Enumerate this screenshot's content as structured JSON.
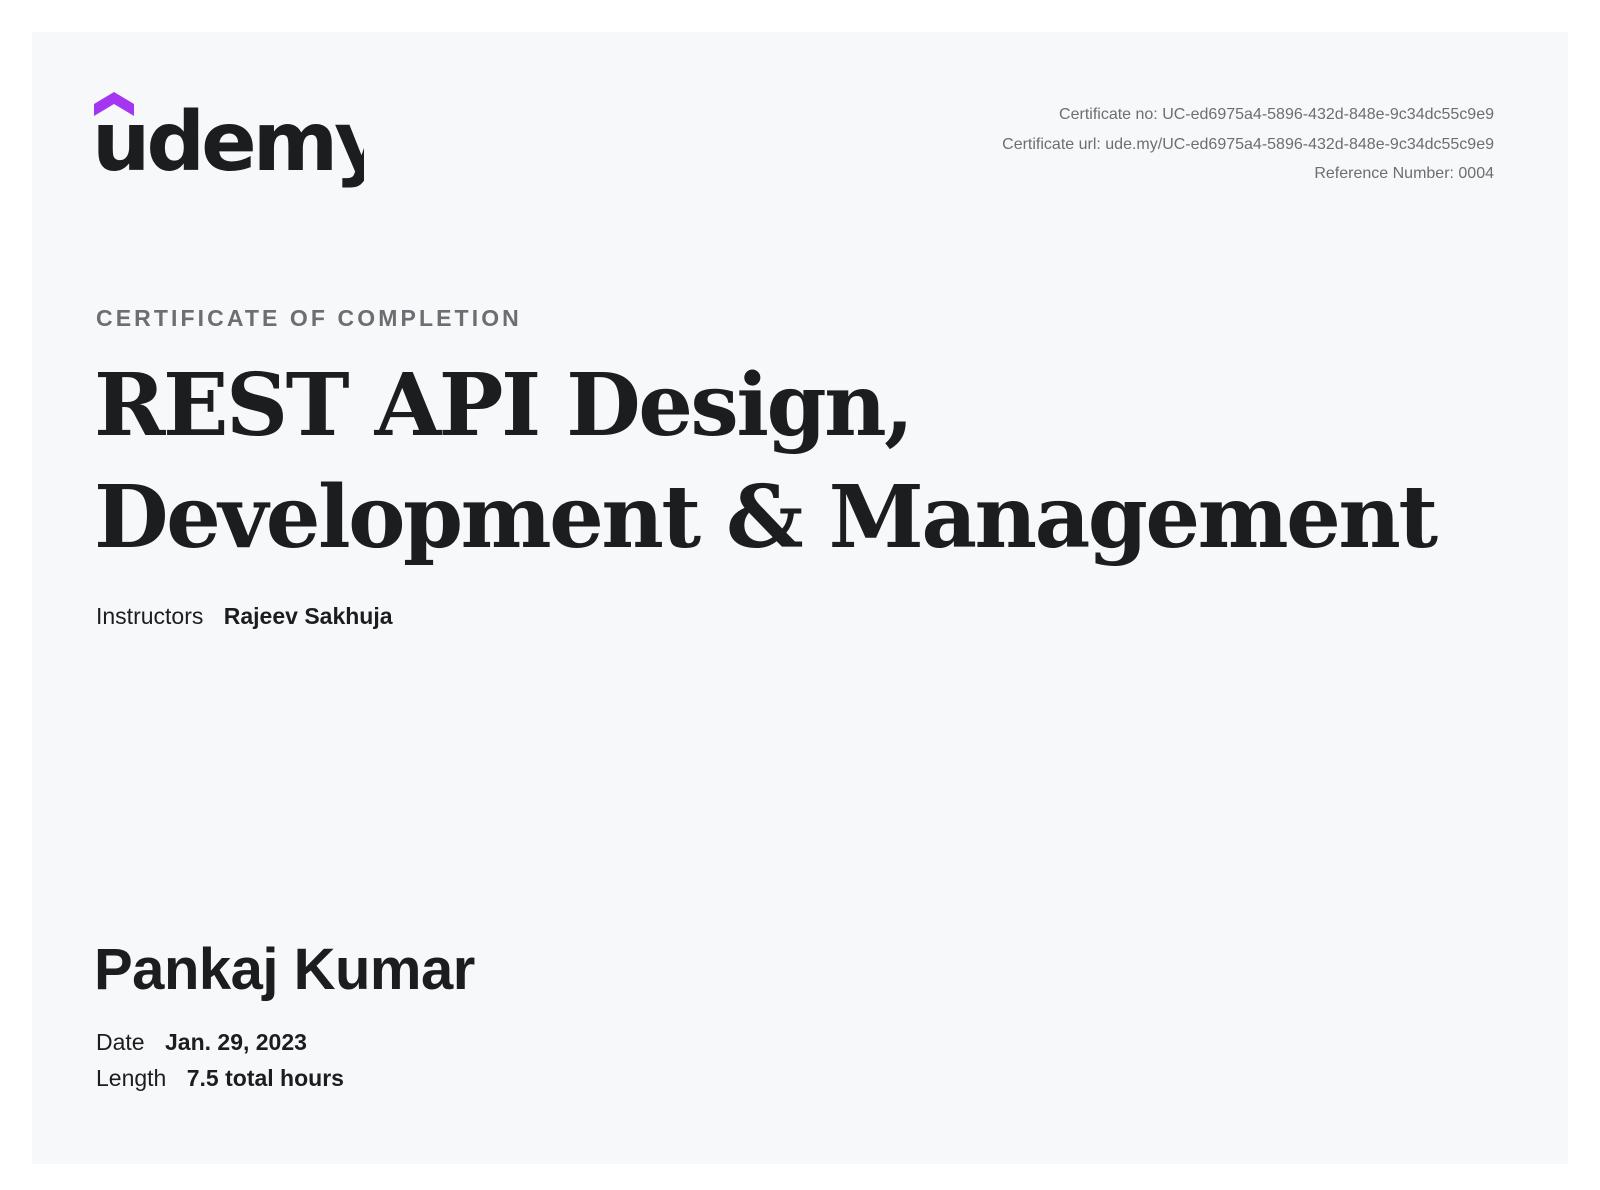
{
  "brand": {
    "name": "udemy",
    "accent_color": "#a435f0",
    "text_color": "#1c1d1f"
  },
  "meta": {
    "certificate_no": "Certificate no: UC-ed6975a4-5896-432d-848e-9c34dc55c9e9",
    "certificate_url": "Certificate url: ude.my/UC-ed6975a4-5896-432d-848e-9c34dc55c9e9",
    "reference_number": "Reference Number: 0004"
  },
  "certificate": {
    "eyebrow": "CERTIFICATE OF COMPLETION",
    "course_title": "REST API Design, Development & Management",
    "instructors_label": "Instructors",
    "instructors_value": "Rajeev Sakhuja",
    "student_name": "Pankaj Kumar",
    "date_label": "Date",
    "date_value": "Jan. 29, 2023",
    "length_label": "Length",
    "length_value": "7.5 total hours"
  }
}
